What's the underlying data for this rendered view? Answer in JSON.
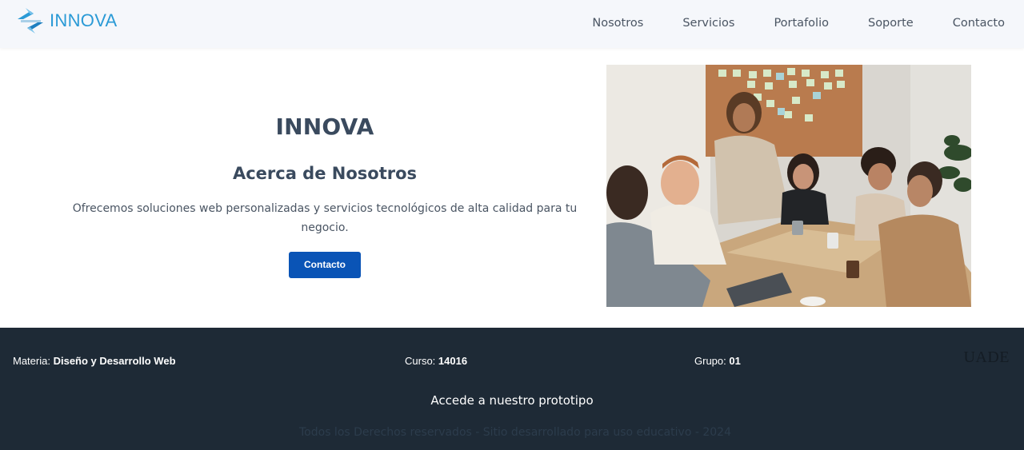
{
  "header": {
    "brand": "INNOVA",
    "nav": [
      "Nosotros",
      "Servicios",
      "Portafolio",
      "Soporte",
      "Contacto"
    ]
  },
  "hero": {
    "title": "INNOVA",
    "subtitle": "Acerca de Nosotros",
    "description": "Ofrecemos soluciones web personalizadas y servicios tecnológicos de alta calidad para tu negocio.",
    "button": "Contacto"
  },
  "footer": {
    "materia_label": "Materia:",
    "materia_value": "Diseño y Desarrollo Web",
    "curso_label": "Curso:",
    "curso_value": "14016",
    "grupo_label": "Grupo:",
    "grupo_value": "01",
    "uade": "UADE",
    "prototype_link": "Accede a nuestro prototipo",
    "copyright": "Todos los Derechos reservados - Sitio desarrollado para uso educativo - 2024"
  },
  "colors": {
    "accent": "#2a9ad6",
    "button": "#0a54b6",
    "footer_bg": "#1e2a36",
    "header_bg": "#f5f7fb"
  }
}
